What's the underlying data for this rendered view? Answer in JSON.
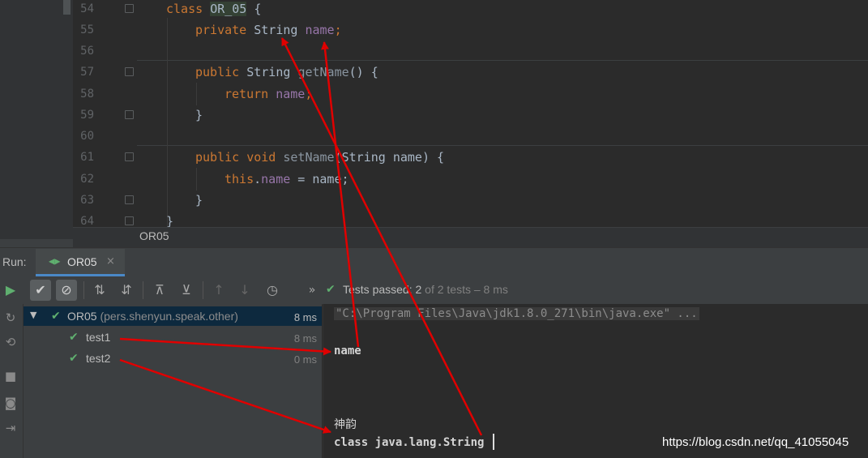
{
  "editor": {
    "lines": [
      {
        "num": "54"
      },
      {
        "num": "55"
      },
      {
        "num": "56"
      },
      {
        "num": "57"
      },
      {
        "num": "58"
      },
      {
        "num": "59"
      },
      {
        "num": "60"
      },
      {
        "num": "61"
      },
      {
        "num": "62"
      },
      {
        "num": "63"
      },
      {
        "num": "64"
      }
    ],
    "code": {
      "kw_class": "class",
      "class_name": "OR_05",
      "open_brace": " {",
      "kw_private": "private",
      "type_string": " String ",
      "field_name": "name",
      "semicolon": ";",
      "kw_public": "public",
      "getter_type": " String ",
      "getter_name": "getName",
      "getter_sig": "() {",
      "kw_return": "return",
      "return_space": " ",
      "return_field": "name",
      "close_brace": "}",
      "setter_public": "public",
      "kw_void": " void ",
      "setter_name": "setName",
      "setter_sig": "(String name) {",
      "kw_this": "this",
      "dot": ".",
      "this_field": "name",
      "assign": " = name;",
      "setter_close": "}",
      "class_close": "}"
    }
  },
  "breadcrumb": {
    "item": "OR05"
  },
  "run": {
    "label": "Run:",
    "tab_label": "OR05",
    "tab_close": "×"
  },
  "toolbar": {
    "overflow": "»",
    "status_check": "✔",
    "status_main": "Tests passed: 2",
    "status_rest": " of 2 tests – 8 ms"
  },
  "tree": {
    "root": {
      "name": "OR05",
      "package": "(pers.shenyun.speak.other)",
      "time": "8 ms"
    },
    "children": [
      {
        "name": "test1",
        "time": "8 ms"
      },
      {
        "name": "test2",
        "time": "0 ms"
      }
    ]
  },
  "console": {
    "command": "\"C:\\Program Files\\Java\\jdk1.8.0_271\\bin\\java.exe\" ...",
    "out_name": "name",
    "out_chinese": "神韵",
    "out_class": "class java.lang.String"
  },
  "watermark": "https://blog.csdn.net/qq_41055045",
  "colors": {
    "keyword": "#cc7832",
    "field": "#9876aa",
    "method": "#ffc66d",
    "annotation_arrow": "#e00000",
    "pass_green": "#5faf6f"
  }
}
